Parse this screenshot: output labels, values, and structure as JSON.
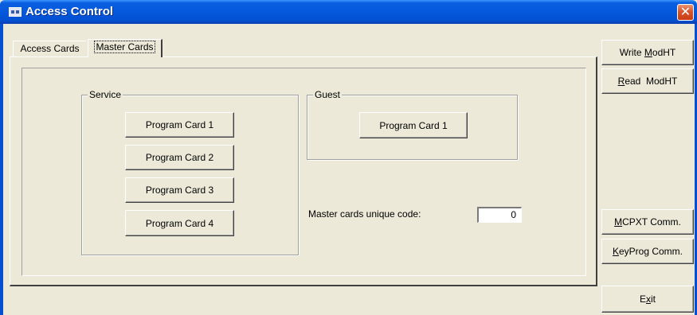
{
  "window": {
    "title": "Access Control",
    "close_glyph": "✕",
    "title_icon": "app-icon",
    "colors": {
      "titlebar": "#0458dc",
      "face": "#ece9d8",
      "close": "#d9542c"
    }
  },
  "tabs": [
    {
      "label": "Access Cards",
      "selected": false
    },
    {
      "label": "Master Cards",
      "selected": true
    }
  ],
  "service": {
    "label": "Service",
    "buttons": [
      "Program Card 1",
      "Program Card 2",
      "Program Card 3",
      "Program Card 4"
    ]
  },
  "guest": {
    "label": "Guest",
    "button": "Program Card 1"
  },
  "unique_code": {
    "label": "Master cards unique code:",
    "value": "0"
  },
  "side_buttons": {
    "write": {
      "pre": "Write ",
      "accel": "M",
      "post": "odHT"
    },
    "read": {
      "pre": "",
      "accel": "R",
      "post": "ead  ModHT"
    },
    "mcpxt": {
      "pre": "",
      "accel": "M",
      "post": "CPXT Comm."
    },
    "keyprog": {
      "pre": "",
      "accel": "K",
      "post": "eyProg Comm."
    },
    "exit": {
      "pre": "E",
      "accel": "x",
      "post": "it"
    }
  }
}
